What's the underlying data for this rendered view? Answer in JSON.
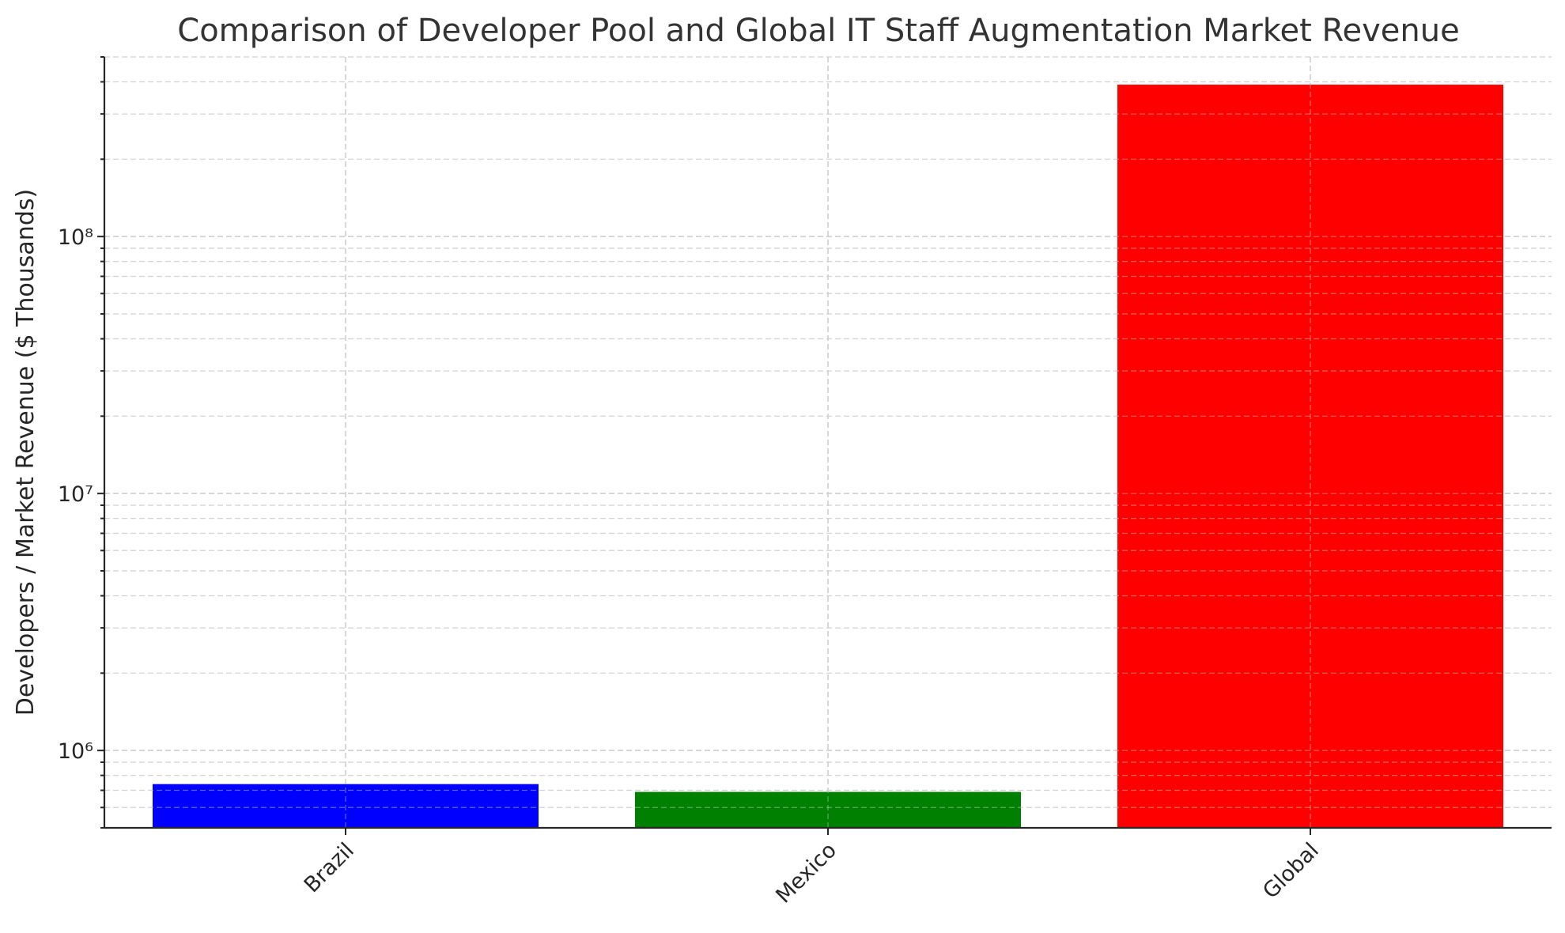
{
  "chart_data": {
    "type": "bar",
    "title": "Comparison of Developer Pool and Global IT Staff Augmentation Market Revenue",
    "xlabel": "",
    "ylabel": "Developers / Market Revenue ($ Thousands)",
    "yscale": "log",
    "ylim": [
      500000,
      500000000
    ],
    "categories": [
      "Brazil",
      "Mexico",
      "Global"
    ],
    "values": [
      740000,
      690000,
      390000000
    ],
    "colors": [
      "#0000ff",
      "#008000",
      "#ff0000"
    ],
    "yticks": [
      {
        "value": 1000000,
        "label": "10⁶"
      },
      {
        "value": 10000000,
        "label": "10⁷"
      },
      {
        "value": 100000000,
        "label": "10⁸"
      }
    ],
    "grid": true,
    "x_tick_rotation": 45
  }
}
